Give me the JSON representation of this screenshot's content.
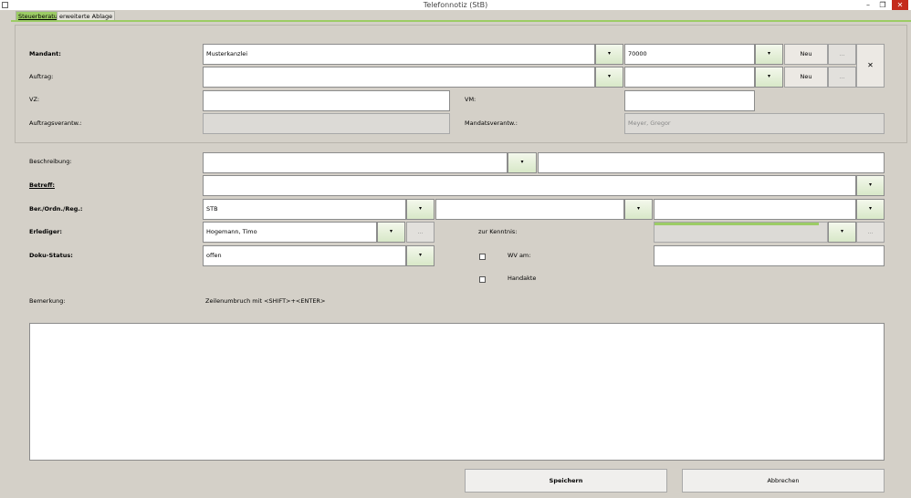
{
  "window": {
    "title": "Telefonnotiz (StB)",
    "minimize": "–",
    "restore": "❐",
    "close": "✕"
  },
  "tabs": [
    {
      "label": "Steuerberatung"
    },
    {
      "label": "erweiterte Ablage"
    }
  ],
  "form": {
    "mandant_label": "Mandant:",
    "mandant_value": "Musterkanzlei",
    "mandant_nr": "70000",
    "neu_label": "Neu",
    "dots": "...",
    "clear_icon": "✕",
    "auftrag_label": "Auftrag:",
    "vz_label": "VZ:",
    "vm_label": "VM:",
    "auftragsverantw_label": "Auftragsverantw.:",
    "mandatsverantw_label": "Mandatsverantw.:",
    "mandatsverantw_value": "Meyer, Gregor",
    "beschreibung_label": "Beschreibung:",
    "betreff_label": "Betreff:",
    "ber_label": "Ber./Ordn./Reg.:",
    "ber_value": "STB",
    "erlediger_label": "Erlediger:",
    "erlediger_value": "Hogemann, Timo",
    "zur_kenntnis_label": "zur Kenntnis:",
    "doku_status_label": "Doku-Status:",
    "doku_status_value": "offen",
    "wv_am_label": "WV am:",
    "handakte_label": "Handakte",
    "bemerkung_label": "Bemerkung:",
    "zeilenumbruch_hint": "Zeilenumbruch mit <SHIFT>+<ENTER>",
    "dropdown_arrow": "▾"
  },
  "buttons": {
    "save": "Speichern",
    "cancel": "Abbrechen"
  }
}
